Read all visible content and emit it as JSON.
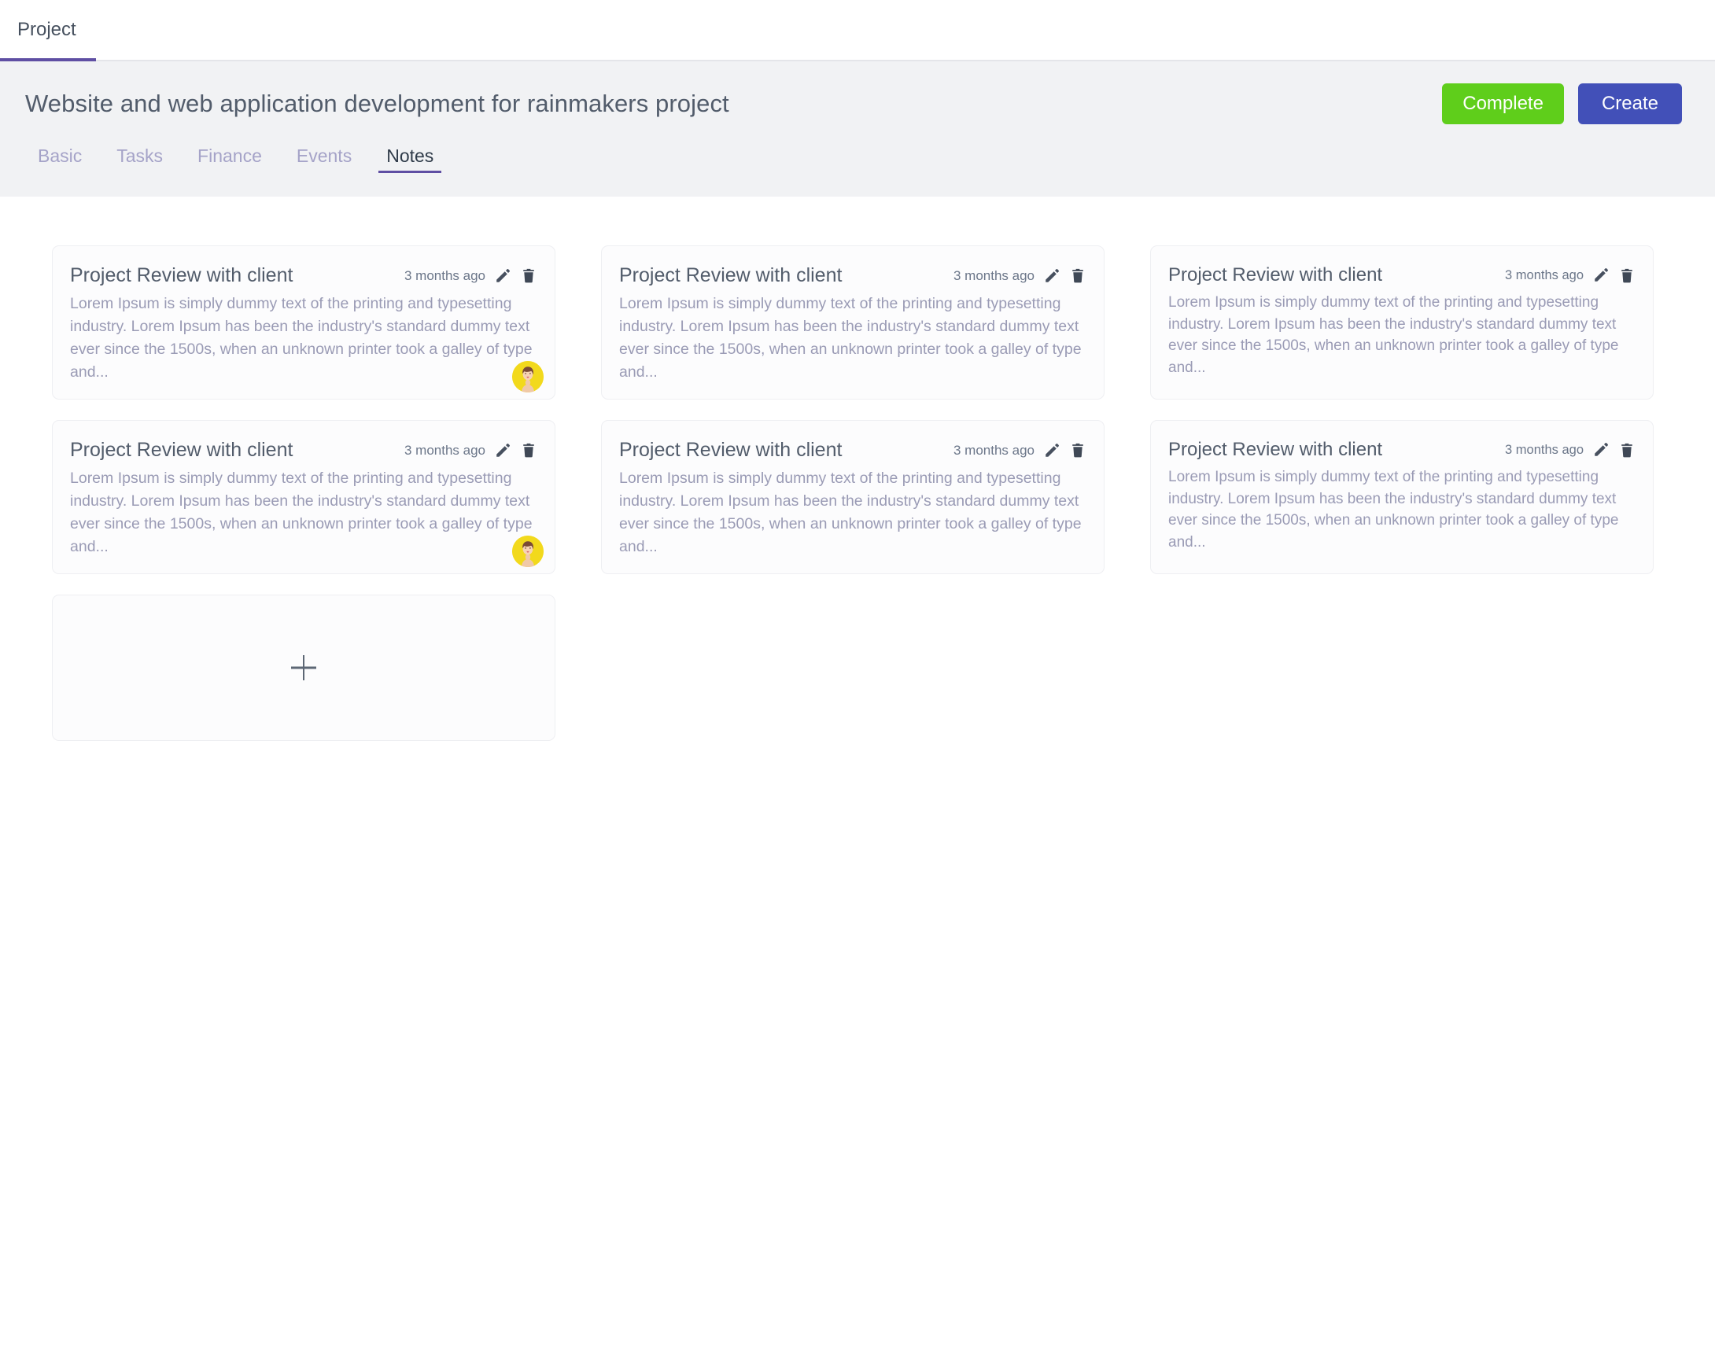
{
  "topbar": {
    "tab_label": "Project",
    "accent_color": "#5F4FA3"
  },
  "header": {
    "project_title": "Website and web application development for rainmakers project",
    "complete_label": "Complete",
    "create_label": "Create",
    "complete_color": "#5FCE1B",
    "create_color": "#4250B8",
    "band_color": "#F1F2F4"
  },
  "tabs": [
    {
      "label": "Basic",
      "active": false
    },
    {
      "label": "Tasks",
      "active": false
    },
    {
      "label": "Finance",
      "active": false
    },
    {
      "label": "Events",
      "active": false
    },
    {
      "label": "Notes",
      "active": true
    }
  ],
  "notes": [
    {
      "title": "Project Review with client",
      "time": "3 months ago",
      "body": "Lorem Ipsum is simply dummy text of the printing and typesetting industry. Lorem Ipsum has been the industry's standard dummy  text ever since the 1500s, when an unknown printer took a galley of  type and...",
      "has_avatar": true,
      "edit_icon": "pencil-icon",
      "delete_icon": "trash-icon"
    },
    {
      "title": "Project Review with client",
      "time": "3 months ago",
      "body": "Lorem Ipsum is simply dummy text of the printing and typesetting industry. Lorem Ipsum has been the industry's standard dummy  text ever since the 1500s, when an unknown printer took a galley of  type and...",
      "has_avatar": false,
      "edit_icon": "pencil-icon",
      "delete_icon": "trash-icon"
    },
    {
      "title": "Project Review with client",
      "time": "3 months ago",
      "body": "Lorem Ipsum is simply dummy text of the printing and typesetting industry. Lorem Ipsum has been the industry's standard dummy  text ever since the 1500s, when an unknown printer took a galley of  type and...",
      "has_avatar": false,
      "edit_icon": "pencil-icon",
      "delete_icon": "trash-icon"
    },
    {
      "title": "Project Review with client",
      "time": "3 months ago",
      "body": "Lorem Ipsum is simply dummy text of the printing and typesetting industry. Lorem Ipsum has been the industry's standard dummy  text ever since the 1500s, when an unknown printer took a galley of  type and...",
      "has_avatar": true,
      "edit_icon": "pencil-icon",
      "delete_icon": "trash-icon"
    },
    {
      "title": "Project Review with client",
      "time": "3 months ago",
      "body": "Lorem Ipsum is simply dummy text of the printing and typesetting industry. Lorem Ipsum has been the industry's standard dummy  text ever since the 1500s, when an unknown printer took a galley of  type and...",
      "has_avatar": false,
      "edit_icon": "pencil-icon",
      "delete_icon": "trash-icon"
    },
    {
      "title": "Project Review with client",
      "time": "3 months ago",
      "body": "Lorem Ipsum is simply dummy text of the printing and typesetting industry. Lorem Ipsum has been the industry's standard dummy  text ever since the 1500s, when an unknown printer took a galley of  type and...",
      "has_avatar": false,
      "edit_icon": "pencil-icon",
      "delete_icon": "trash-icon"
    }
  ],
  "add_note": {
    "icon": "plus-icon"
  }
}
